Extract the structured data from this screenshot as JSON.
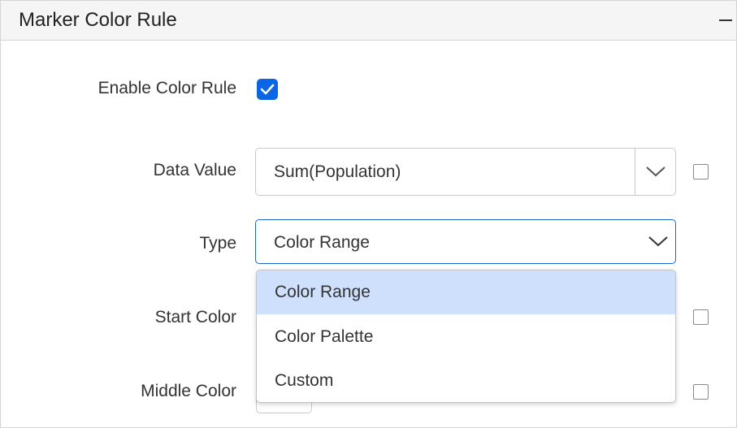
{
  "panel": {
    "title": "Marker Color Rule",
    "collapse_icon": "minus-icon"
  },
  "form": {
    "enable_label": "Enable Color Rule",
    "enable_checked": true,
    "data_value_label": "Data Value",
    "data_value": "Sum(Population)",
    "type_label": "Type",
    "type_value": "Color Range",
    "start_color_label": "Start Color",
    "middle_color_label": "Middle Color"
  },
  "type_options": [
    {
      "label": "Color Range",
      "selected": true
    },
    {
      "label": "Color Palette",
      "selected": false
    },
    {
      "label": "Custom",
      "selected": false
    }
  ],
  "colors": {
    "accent": "#0a66e4",
    "focus_border": "#1a66cc",
    "selected_option_bg": "#cfe0fc"
  }
}
